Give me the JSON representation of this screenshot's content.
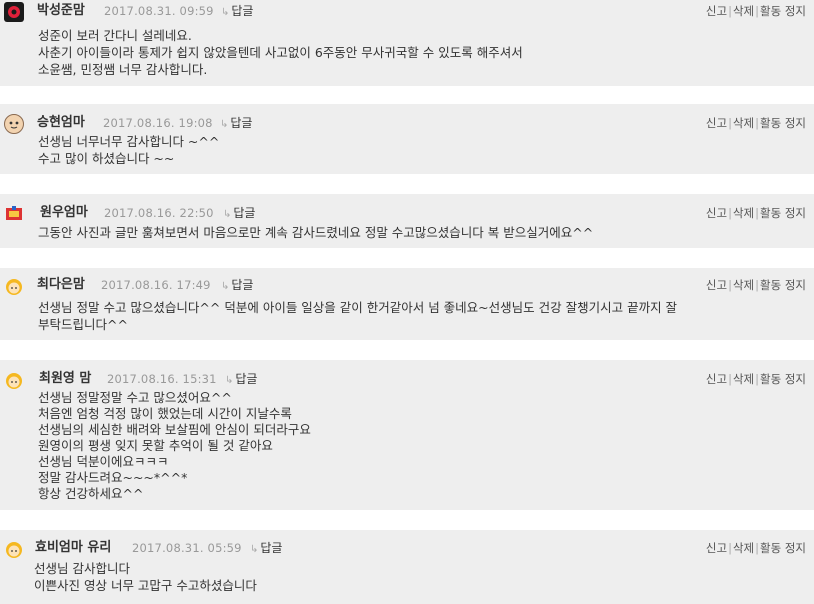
{
  "actions": {
    "report": "신고",
    "delete": "삭제",
    "suspend": "활동 정지",
    "reply": "답글"
  },
  "comments": [
    {
      "name": "박성준맘",
      "date": "2017.08.31. 09:59",
      "lines": [
        "성준이 보러 간다니 설레네요.",
        "사춘기 아이들이라 통제가 쉽지 않았을텐데 사고없이 6주동안 무사귀국할 수 있도록 해주셔서",
        "소윤쌤, 민정쌤 너무 감사합니다."
      ]
    },
    {
      "name": "승현엄마",
      "date": "2017.08.16. 19:08",
      "lines": [
        "선생님 너무너무 감사합니다 ~^^",
        "수고 많이 하셨습니다 ~~"
      ]
    },
    {
      "name": "원우엄마",
      "date": "2017.08.16. 22:50",
      "lines": [
        "그동안 사진과 글만 훔쳐보면서 마음으로만 계속 감사드렸네요 정말 수고많으셨습니다 복 받으실거에요^^"
      ]
    },
    {
      "name": "최다은맘",
      "date": "2017.08.16. 17:49",
      "lines": [
        "선생님 정말 수고 많으셨습니다^^ 덕분에 아이들 일상을 같이 한거같아서 넘 좋네요~선생님도 건강 잘챙기시고 끝까지 잘",
        "부탁드립니다^^"
      ]
    },
    {
      "name": "최원영 맘",
      "date": "2017.08.16. 15:31",
      "lines": [
        "선생님 정말정말 수고 많으셨어요^^",
        "처음엔 엄청 걱정 많이 했었는데 시간이 지날수록",
        "선생님의 세심한 배려와 보살핌에 안심이 되더라구요",
        "원영이의 평생 잊지 못할 추억이 될 것 같아요",
        "선생님 덕분이에요ㅋㅋㅋ",
        "정말 감사드려요~~~*^^*",
        "항상 건강하세요^^"
      ]
    },
    {
      "name": "효비엄마 유리",
      "date": "2017.08.31. 05:59",
      "lines": [
        "선생님 감사합니다",
        "이쁜사진 영상 너무 고맙구 수고하셨습니다"
      ]
    }
  ]
}
